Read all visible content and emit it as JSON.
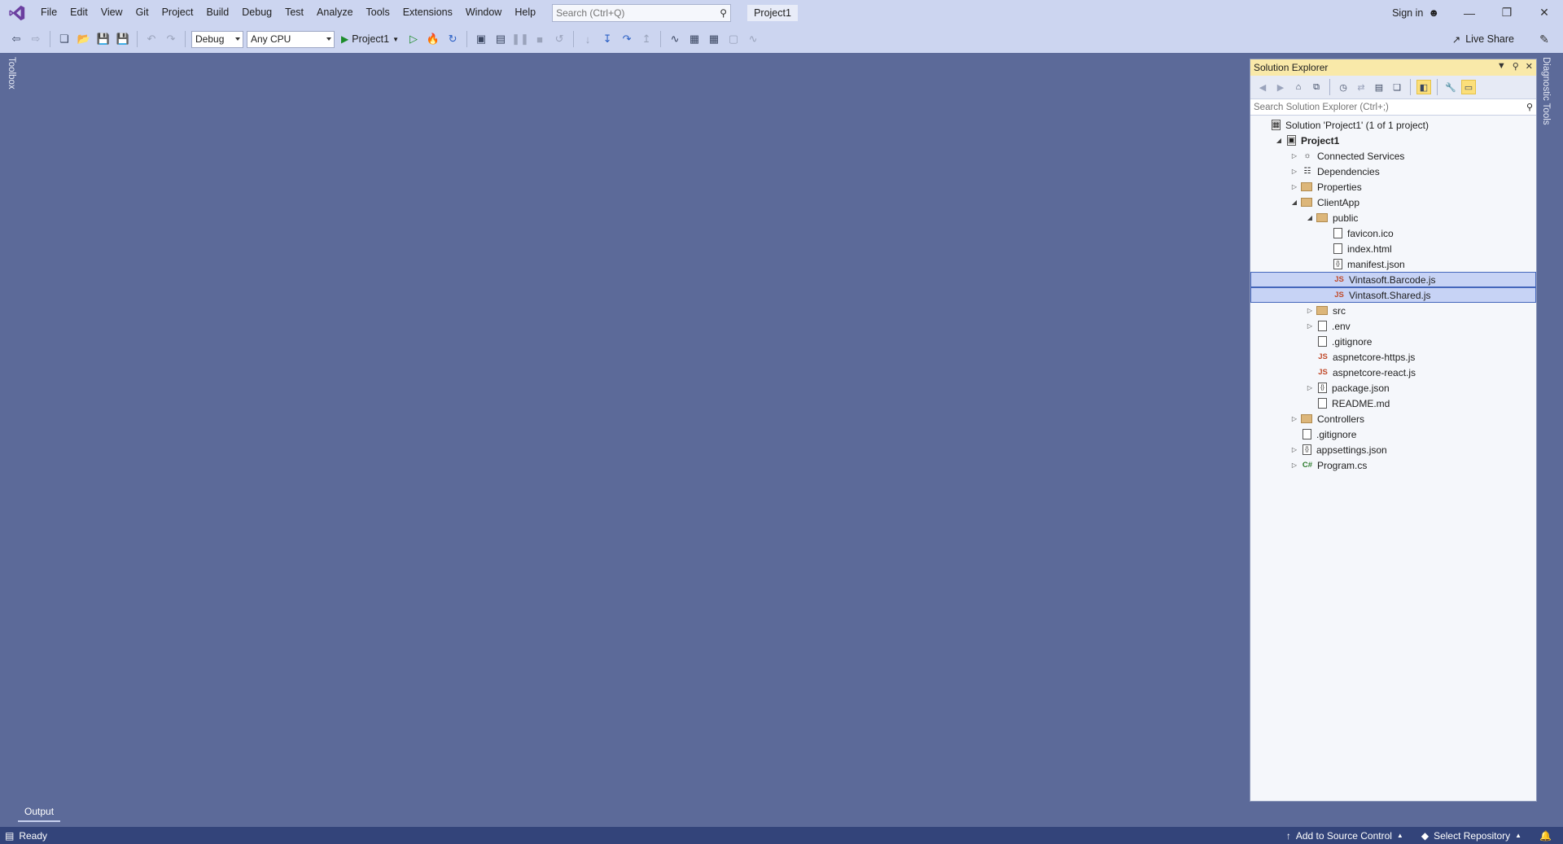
{
  "menu": [
    "File",
    "Edit",
    "View",
    "Git",
    "Project",
    "Build",
    "Debug",
    "Test",
    "Analyze",
    "Tools",
    "Extensions",
    "Window",
    "Help"
  ],
  "search": {
    "placeholder": "Search (Ctrl+Q)"
  },
  "project_badge": "Project1",
  "signin": "Sign in",
  "toolbar": {
    "config": "Debug",
    "platform": "Any CPU",
    "start_target": "Project1",
    "live_share": "Live Share"
  },
  "side_tabs": {
    "toolbox": "Toolbox",
    "diagnostic": "Diagnostic Tools"
  },
  "solution_explorer": {
    "title": "Solution Explorer",
    "search_placeholder": "Search Solution Explorer (Ctrl+;)",
    "tree": [
      {
        "label": "Solution 'Project1' (1 of 1 project)",
        "indent": 0,
        "expander": "",
        "icon": "solution-icon",
        "bold": false,
        "selected": false
      },
      {
        "label": "Project1",
        "indent": 1,
        "expander": "open",
        "icon": "project-icon",
        "bold": true,
        "selected": false
      },
      {
        "label": "Connected Services",
        "indent": 2,
        "expander": "closed",
        "icon": "connected-services-icon",
        "bold": false,
        "selected": false
      },
      {
        "label": "Dependencies",
        "indent": 2,
        "expander": "closed",
        "icon": "dependencies-icon",
        "bold": false,
        "selected": false
      },
      {
        "label": "Properties",
        "indent": 2,
        "expander": "closed",
        "icon": "folder-icon",
        "bold": false,
        "selected": false
      },
      {
        "label": "ClientApp",
        "indent": 2,
        "expander": "open",
        "icon": "folder-icon",
        "bold": false,
        "selected": false
      },
      {
        "label": "public",
        "indent": 3,
        "expander": "open",
        "icon": "folder-icon",
        "bold": false,
        "selected": false
      },
      {
        "label": "favicon.ico",
        "indent": 4,
        "expander": "",
        "icon": "image-file-icon",
        "bold": false,
        "selected": false
      },
      {
        "label": "index.html",
        "indent": 4,
        "expander": "",
        "icon": "html-file-icon",
        "bold": false,
        "selected": false
      },
      {
        "label": "manifest.json",
        "indent": 4,
        "expander": "",
        "icon": "json-file-icon",
        "bold": false,
        "selected": false
      },
      {
        "label": "Vintasoft.Barcode.js",
        "indent": 4,
        "expander": "",
        "icon": "js-file-icon",
        "bold": false,
        "selected": true
      },
      {
        "label": "Vintasoft.Shared.js",
        "indent": 4,
        "expander": "",
        "icon": "js-file-icon",
        "bold": false,
        "selected": true
      },
      {
        "label": "src",
        "indent": 3,
        "expander": "closed",
        "icon": "folder-icon",
        "bold": false,
        "selected": false
      },
      {
        "label": ".env",
        "indent": 3,
        "expander": "closed",
        "icon": "file-icon",
        "bold": false,
        "selected": false
      },
      {
        "label": ".gitignore",
        "indent": 3,
        "expander": "",
        "icon": "file-icon",
        "bold": false,
        "selected": false
      },
      {
        "label": "aspnetcore-https.js",
        "indent": 3,
        "expander": "",
        "icon": "js-file-icon",
        "bold": false,
        "selected": false
      },
      {
        "label": "aspnetcore-react.js",
        "indent": 3,
        "expander": "",
        "icon": "js-file-icon",
        "bold": false,
        "selected": false
      },
      {
        "label": "package.json",
        "indent": 3,
        "expander": "closed",
        "icon": "json-file-icon",
        "bold": false,
        "selected": false
      },
      {
        "label": "README.md",
        "indent": 3,
        "expander": "",
        "icon": "markdown-file-icon",
        "bold": false,
        "selected": false
      },
      {
        "label": "Controllers",
        "indent": 2,
        "expander": "closed",
        "icon": "folder-icon",
        "bold": false,
        "selected": false
      },
      {
        "label": ".gitignore",
        "indent": 2,
        "expander": "",
        "icon": "file-icon",
        "bold": false,
        "selected": false
      },
      {
        "label": "appsettings.json",
        "indent": 2,
        "expander": "closed",
        "icon": "json-file-icon",
        "bold": false,
        "selected": false
      },
      {
        "label": "Program.cs",
        "indent": 2,
        "expander": "closed",
        "icon": "csharp-file-icon",
        "bold": false,
        "selected": false
      }
    ]
  },
  "output_tab": "Output",
  "status": {
    "ready": "Ready",
    "add_source_control": "Add to Source Control",
    "select_repository": "Select Repository"
  },
  "colors": {
    "editor_bg": "#5c6a99",
    "chrome_bg": "#ccd5f0",
    "status_bg": "#33447a",
    "panel_header": "#f9e9a9",
    "selection": "#c7d3f5"
  }
}
